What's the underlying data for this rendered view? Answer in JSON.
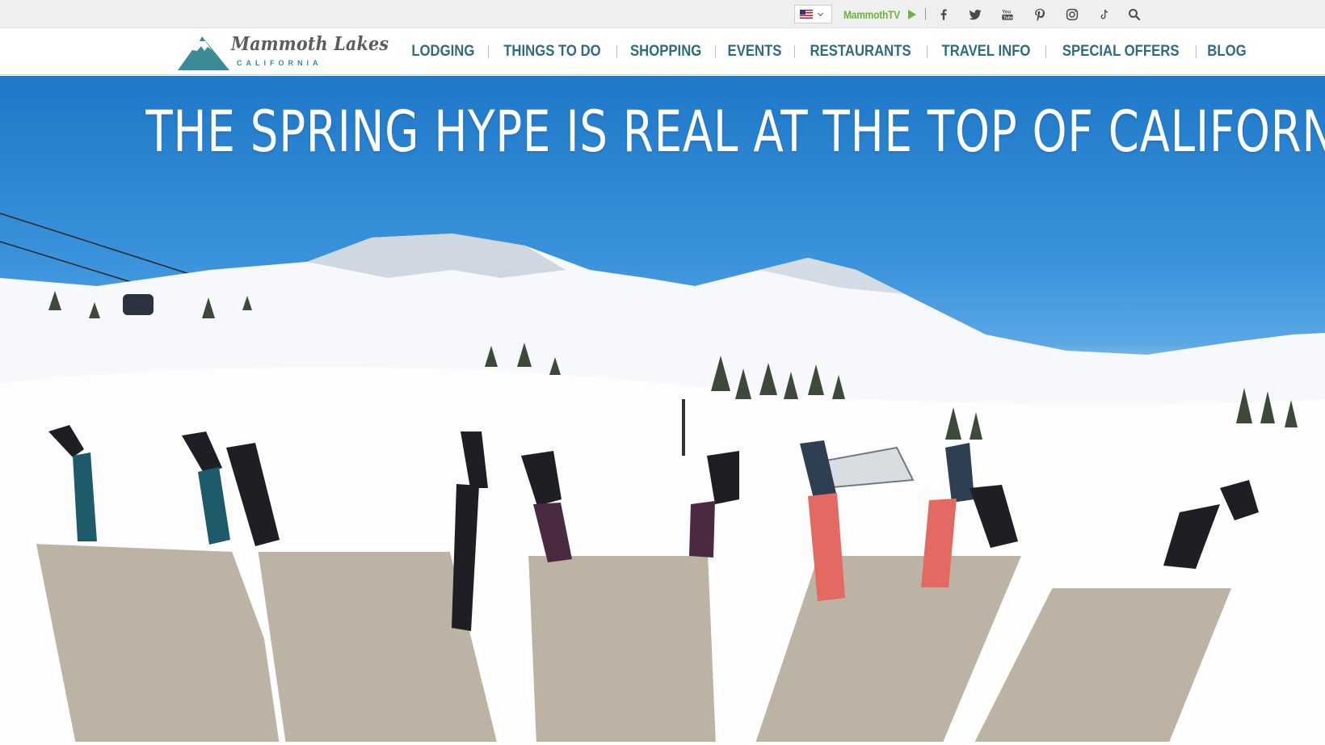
{
  "utility": {
    "language_flag": "us-flag-icon",
    "mammoth_tv_label": "MammothTV",
    "social": [
      {
        "name": "facebook-icon"
      },
      {
        "name": "twitter-icon"
      },
      {
        "name": "youtube-icon"
      },
      {
        "name": "pinterest-icon"
      },
      {
        "name": "instagram-icon"
      },
      {
        "name": "tiktok-icon"
      },
      {
        "name": "search-icon"
      }
    ]
  },
  "brand": {
    "wordmark": "Mammoth Lakes",
    "subtitle": "CALIFORNIA"
  },
  "nav": {
    "items": [
      {
        "label": "LODGING"
      },
      {
        "label": "THINGS TO DO"
      },
      {
        "label": "SHOPPING"
      },
      {
        "label": "EVENTS"
      },
      {
        "label": "RESTAURANTS"
      },
      {
        "label": "TRAVEL INFO"
      },
      {
        "label": "SPECIAL OFFERS"
      },
      {
        "label": "BLOG"
      }
    ]
  },
  "hero": {
    "headline": "THE SPRING HYPE IS REAL AT THE TOP OF CALIFORNIA",
    "image_alt_subject": "skiers in lounge chairs raising gloved hands at a snowy mountain"
  },
  "colors": {
    "nav_text": "#2f6b7e",
    "accent_green": "#6db33f",
    "logo_teal": "#3b8a97",
    "sky": "#2a82d0"
  }
}
